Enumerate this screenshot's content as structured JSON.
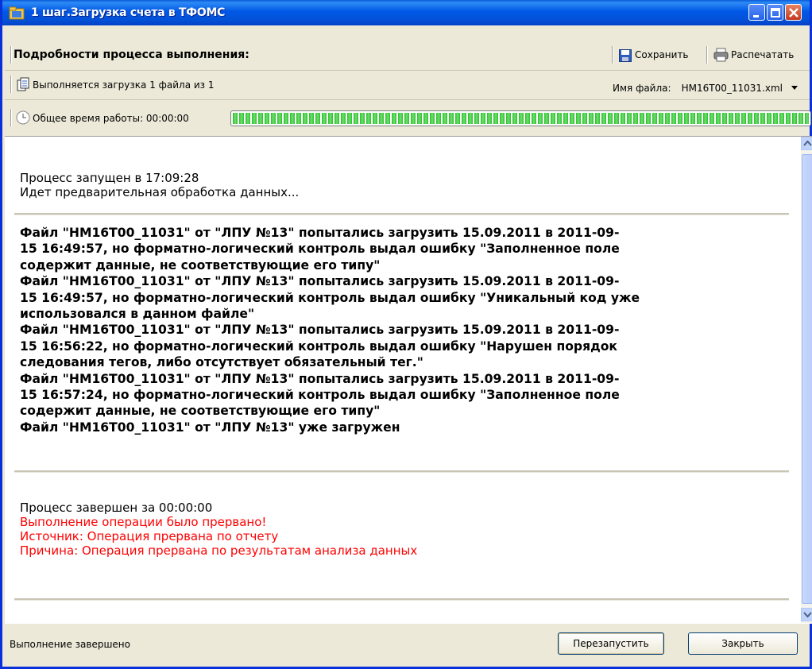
{
  "window": {
    "title": "1 шаг.Загрузка счета в ТФОМС",
    "buttons": [
      "minimize",
      "maximize",
      "close"
    ]
  },
  "toolbar": {
    "section_title": "Подробности процесса выполнения:",
    "save_label": "Сохранить",
    "print_label": "Распечатать"
  },
  "status_row": {
    "loading_text": "Выполняется загрузка 1 файла из 1",
    "file_label": "Имя файла:",
    "file_name": "HM16T00_11031.xml"
  },
  "time_row": {
    "total_time": "Общее время работы: 00:00:00",
    "progress_percent": 100
  },
  "log": {
    "start": [
      "Процесс запущен в 17:09:28",
      "Идет предварительная обработка данных..."
    ],
    "errors": [
      "Файл \"HM16T00_11031\" от \"ЛПУ №13\" попытались загрузить 15.09.2011 в 2011-09-",
      "15 16:49:57, но форматно-логический контроль выдал ошибку \"Заполненное поле",
      "содержит данные, не соответствующие его типу\"",
      "Файл \"HM16T00_11031\" от \"ЛПУ №13\" попытались загрузить 15.09.2011 в 2011-09-",
      "15 16:49:57, но форматно-логический контроль выдал ошибку \"Уникальный код уже",
      "использовался в данном файле\"",
      "Файл \"HM16T00_11031\" от \"ЛПУ №13\" попытались загрузить 15.09.2011 в 2011-09-",
      "15 16:56:22, но форматно-логический контроль выдал ошибку \"Нарушен порядок",
      "следования тегов, либо отсутствует обязательный тег.\"",
      "Файл \"HM16T00_11031\" от \"ЛПУ №13\" попытались загрузить 15.09.2011 в 2011-09-",
      "15 16:57:24, но форматно-логический контроль выдал ошибку \"Заполненное поле",
      "содержит данные, не соответствующие его типу\"",
      "Файл \"HM16T00_11031\" от \"ЛПУ №13\" уже загружен"
    ],
    "finish": "Процесс завершен за 00:00:00",
    "finish_errors": [
      "Выполнение операции было прервано!",
      "Источник: Операция прервана по отчету",
      "Причина: Операция прервана по результатам анализа данных"
    ]
  },
  "footer": {
    "status": "Выполнение завершено",
    "restart_label": "Перезапустить",
    "close_label": "Закрыть"
  },
  "colors": {
    "title_bar": "#0058e6",
    "error_text": "#ff0000",
    "progress": "#2bbe2b"
  }
}
